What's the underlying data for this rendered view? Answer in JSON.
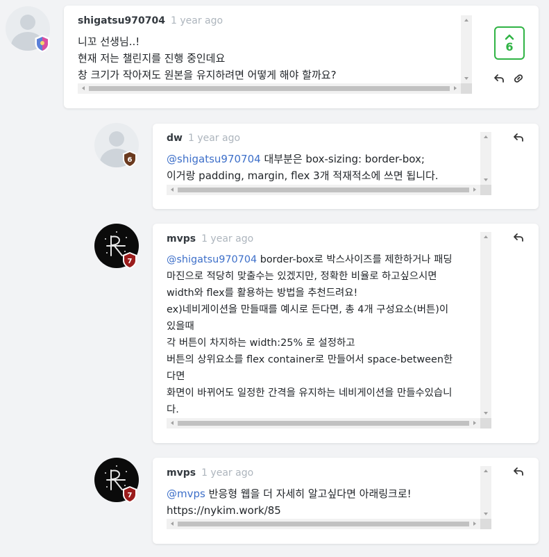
{
  "comments": [
    {
      "user": "shigatsu970704",
      "time": "1 year ago",
      "mention": "",
      "text": "니꼬 선생님..!\n현재 저는 챌린지를 진행 중인데요\n창 크기가 작아져도 원본을 유지하려면 어떻게 해야 할까요?",
      "avatar": "default",
      "badge": {
        "level": "",
        "color": "#3b6fd1"
      },
      "votes": "6",
      "icons": [
        "reply-icon",
        "link-icon"
      ]
    },
    {
      "user": "dw",
      "time": "1 year ago",
      "mention": "@shigatsu970704",
      "text": " 대부분은 box-sizing: border-box;\n이거랑 padding, margin, flex 3개 적재적소에 쓰면 됩니다.",
      "avatar": "default",
      "badge": {
        "level": "6",
        "color": "#6b3a1f"
      },
      "icons": [
        "reply-icon"
      ]
    },
    {
      "user": "mvps",
      "time": "1 year ago",
      "mention": "@shigatsu970704",
      "text": " border-box로 박스사이즈를 제한하거나 패딩\n마진으로 적당히 맞출수는 있겠지만, 정확한 비율로 하고싶으시면\nwidth와 flex를 활용하는 방법을 추천드려요!\nex)네비게이션을 만들때를 예시로 든다면, 총 4개 구성요소(버튼)이\n있을때\n각 버튼이 차지하는 width:25% 로 설정하고\n버튼의 상위요소를 flex container로 만들어서 space-between한\n다면\n화면이 바뀌어도 일정한 간격을 유지하는 네비게이션을 만들수있습니\n다.",
      "avatar": "dark",
      "badge": {
        "level": "7",
        "color": "#9b1c1c"
      },
      "icons": [
        "reply-icon"
      ]
    },
    {
      "user": "mvps",
      "time": "1 year ago",
      "mention": "@mvps",
      "text": " 반응형 웹을 더 자세히 알고싶다면 아래링크로!\nhttps://nykim.work/85",
      "avatar": "dark",
      "badge": {
        "level": "7",
        "color": "#9b1c1c"
      },
      "icons": [
        "reply-icon"
      ]
    }
  ]
}
